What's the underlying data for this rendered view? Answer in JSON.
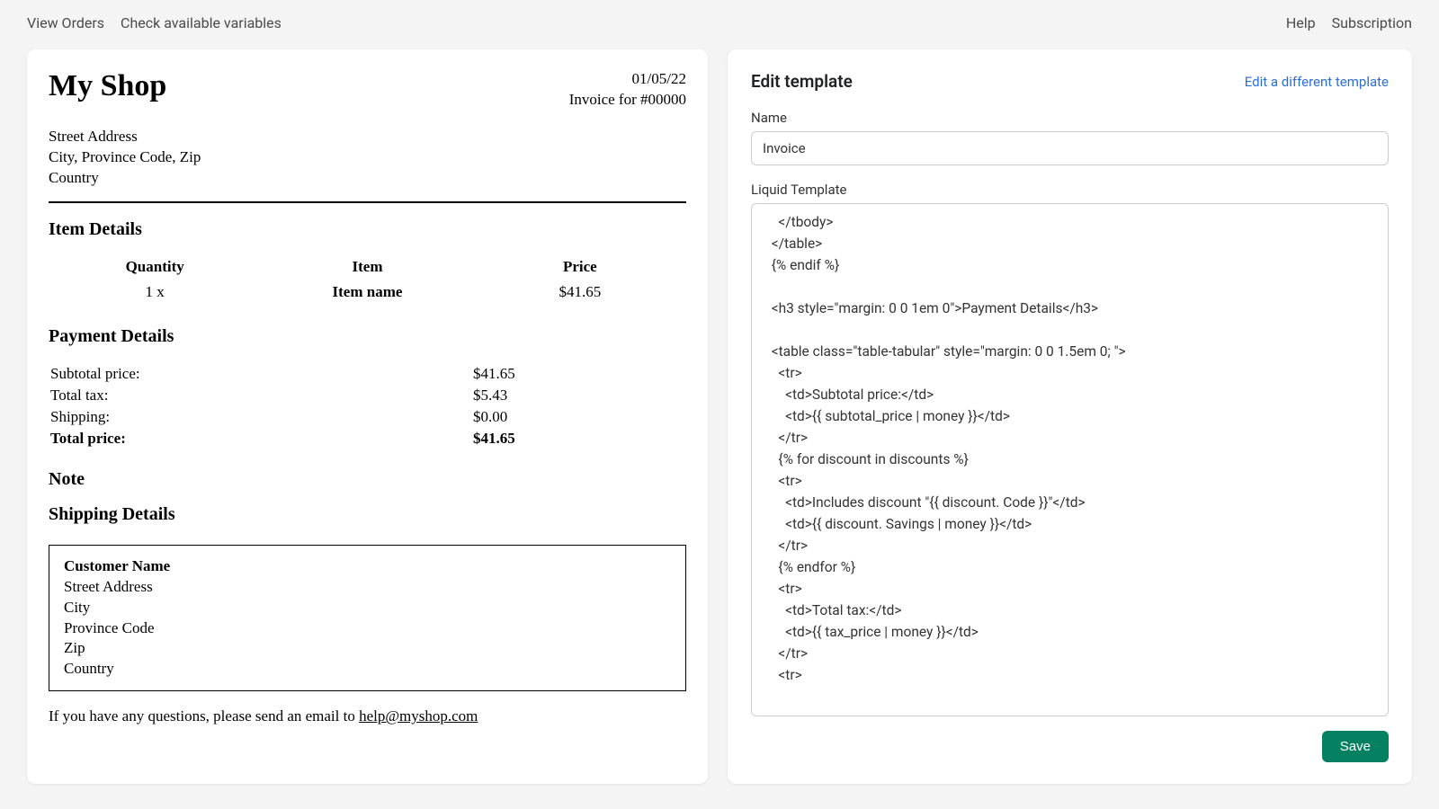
{
  "topbar": {
    "view_orders": "View Orders",
    "check_vars": "Check available variables",
    "help": "Help",
    "subscription": "Subscription"
  },
  "preview": {
    "shop_name": "My Shop",
    "date": "01/05/22",
    "invoice_for": "Invoice for #00000",
    "addr": {
      "street": "Street Address",
      "city_line": "City, Province Code, Zip",
      "country": "Country"
    },
    "sections": {
      "item_details": "Item Details",
      "payment_details": "Payment Details",
      "note": "Note",
      "shipping_details": "Shipping Details"
    },
    "items": {
      "head_qty": "Quantity",
      "head_item": "Item",
      "head_price": "Price",
      "row_qty": "1 x",
      "row_item": "Item name",
      "row_price": "$41.65"
    },
    "payment": {
      "subtotal_label": "Subtotal price:",
      "subtotal_val": "$41.65",
      "tax_label": "Total tax:",
      "tax_val": "$5.43",
      "ship_label": "Shipping:",
      "ship_val": "$0.00",
      "total_label": "Total price:",
      "total_val": "$41.65"
    },
    "ship": {
      "customer": "Customer Name",
      "street": "Street Address",
      "city": "City",
      "province": "Province Code",
      "zip": "Zip",
      "country": "Country"
    },
    "footer": {
      "pre": "If you have any questions, please send an email to ",
      "mail": "help@myshop.com"
    }
  },
  "edit": {
    "title": "Edit template",
    "link": "Edit a different template",
    "name_label": "Name",
    "name_value": "Invoice",
    "liquid_label": "Liquid Template",
    "save": "Save",
    "code": "    </tbody>\n  </table>\n  {% endif %}\n\n  <h3 style=\"margin: 0 0 1em 0\">Payment Details</h3>\n\n  <table class=\"table-tabular\" style=\"margin: 0 0 1.5em 0; \">\n    <tr>\n      <td>Subtotal price:</td>\n      <td>{{ subtotal_price | money }}</td>\n    </tr>\n    {% for discount in discounts %}\n    <tr>\n      <td>Includes discount \"{{ discount. Code }}\"</td>\n      <td>{{ discount. Savings | money }}</td>\n    </tr>\n    {% endfor %}\n    <tr>\n      <td>Total tax:</td>\n      <td>{{ tax_price | money }}</td>\n    </tr>\n    <tr>"
  }
}
